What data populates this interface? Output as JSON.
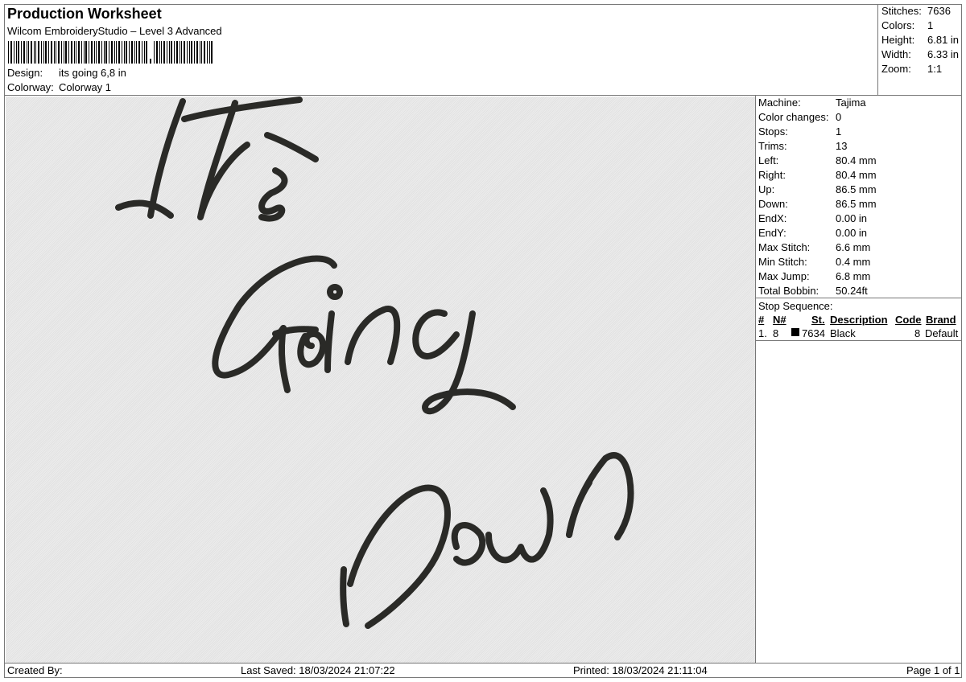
{
  "header": {
    "title": "Production Worksheet",
    "software": "Wilcom EmbroideryStudio – Level 3 Advanced",
    "design_label": "Design:",
    "design_value": "its going 6,8 in",
    "colorway_label": "Colorway:",
    "colorway_value": "Colorway 1"
  },
  "summary": [
    {
      "label": "Stitches:",
      "value": "7636"
    },
    {
      "label": "Colors:",
      "value": "1"
    },
    {
      "label": "Height:",
      "value": "6.81 in"
    },
    {
      "label": "Width:",
      "value": "6.33 in"
    },
    {
      "label": "Zoom:",
      "value": "1:1"
    }
  ],
  "machine_info": [
    {
      "label": "Machine:",
      "value": "Tajima"
    },
    {
      "label": "Color changes:",
      "value": "0"
    },
    {
      "label": "Stops:",
      "value": "1"
    },
    {
      "label": "Trims:",
      "value": "13"
    },
    {
      "label": "Left:",
      "value": "80.4 mm"
    },
    {
      "label": "Right:",
      "value": "80.4 mm"
    },
    {
      "label": "Up:",
      "value": "86.5 mm"
    },
    {
      "label": "Down:",
      "value": "86.5 mm"
    },
    {
      "label": "EndX:",
      "value": "0.00 in"
    },
    {
      "label": "EndY:",
      "value": "0.00 in"
    },
    {
      "label": "Max Stitch:",
      "value": "6.6 mm"
    },
    {
      "label": "Min Stitch:",
      "value": "0.4 mm"
    },
    {
      "label": "Max Jump:",
      "value": "6.8 mm"
    },
    {
      "label": "Total Bobbin:",
      "value": "50.24ft"
    }
  ],
  "stop_sequence": {
    "title": "Stop Sequence:",
    "headers": {
      "num": "#",
      "n": "N#",
      "st": "St.",
      "description": "Description",
      "code": "Code",
      "brand": "Brand"
    },
    "rows": [
      {
        "num": "1.",
        "n": "8",
        "swatch": "#000000",
        "st": "7634",
        "description": "Black",
        "code": "8",
        "brand": "Default"
      }
    ]
  },
  "design_text": [
    "It's",
    "Going",
    "Down"
  ],
  "footer": {
    "created_by": "Created By:",
    "last_saved": "Last Saved: 18/03/2024 21:07:22",
    "printed": "Printed: 18/03/2024 21:11:04",
    "page": "Page 1 of 1"
  },
  "colors": {
    "thread": "#2a2a27",
    "fabric": "#e8e8e8"
  }
}
